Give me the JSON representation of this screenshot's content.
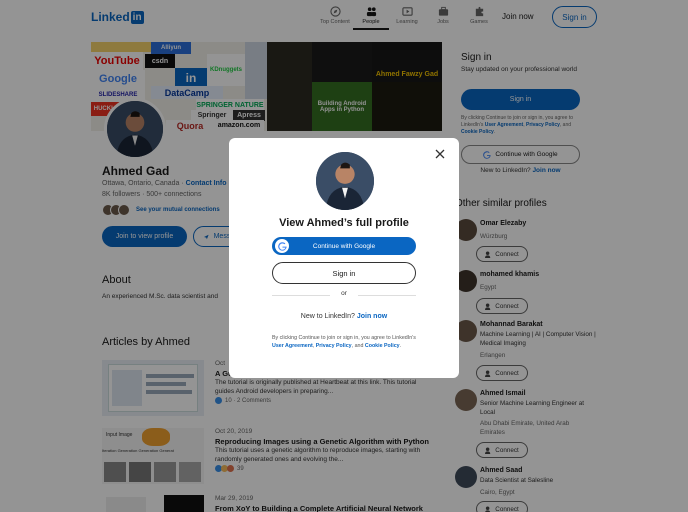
{
  "header": {
    "logo_text": "Linked",
    "logo_in": "in",
    "nav": [
      {
        "label": "Top Content",
        "icon": "compass-icon"
      },
      {
        "label": "People",
        "icon": "people-icon"
      },
      {
        "label": "Learning",
        "icon": "play-icon"
      },
      {
        "label": "Jobs",
        "icon": "briefcase-icon"
      },
      {
        "label": "Games",
        "icon": "puzzle-icon"
      }
    ],
    "join_now": "Join now",
    "sign_in": "Sign in"
  },
  "banner": {
    "tiles": [
      "YouTube",
      "Google",
      "csdn",
      "in",
      "DataCamp",
      "SPRINGER NATURE",
      "Springer",
      "Apress",
      "Quora",
      "amazon.com",
      "Alliyun",
      "KDnuggets",
      "Ahmed Fawzy Gad",
      "Building Android Apps in Python",
      "SLIDESHARE",
      "HUCKLY"
    ]
  },
  "profile": {
    "name": "Ahmed Gad",
    "location": "Ottawa, Ontario, Canada",
    "contact": "Contact Info",
    "followers": "8K followers",
    "connections": "500+ connections",
    "mutual": "See your mutual connections",
    "join_to_view": "Join to view profile",
    "message": "Message"
  },
  "about": {
    "heading": "About",
    "text": "An experienced M.Sc. data scientist and"
  },
  "articles": {
    "heading": "Articles by Ahmed",
    "items": [
      {
        "date": "Oct",
        "title": "A Gu",
        "desc": "The tutorial is originally published at Heartbeat at this link. This tutorial guides Android developers in preparing...",
        "reactions": "10 · 2 Comments"
      },
      {
        "date": "Oct 20, 2019",
        "title": "Reproducing Images using a Genetic Algorithm with Python",
        "desc": "This tutorial uses a genetic algorithm to reproduce images, starting with randomly generated ones and evolving the...",
        "reactions": "39"
      },
      {
        "date": "Mar 29, 2019",
        "title": "From XoY to Building a Complete Artificial Neural Network",
        "desc": "",
        "reactions": ""
      }
    ]
  },
  "sidebar": {
    "heading": "Sign in",
    "subtitle": "Stay updated on your professional world",
    "signin_button": "Sign in",
    "legal_pre": "By clicking Continue to join or sign in, you agree to LinkedIn's ",
    "legal_ua": "User Agreement",
    "legal_mid": ", ",
    "legal_pp": "Privacy Policy",
    "legal_and": ", and ",
    "legal_cp": "Cookie Policy",
    "legal_end": ".",
    "google_button": "Continue with Google",
    "new_to": "New to LinkedIn? ",
    "join": "Join now"
  },
  "similar": {
    "heading": "Other similar profiles",
    "connect_label": "Connect",
    "people": [
      {
        "name": "Omar Elezaby",
        "headline": "",
        "location": "Würzburg"
      },
      {
        "name": "mohamed khamis",
        "headline": "",
        "location": "Egypt"
      },
      {
        "name": "Mohannad Barakat",
        "headline": "Machine Learning | AI | Computer Vision | Medical Imaging",
        "location": "Erlangen"
      },
      {
        "name": "Ahmed Ismail",
        "headline": "Senior Machine Learning Engineer at Local",
        "location": "Abu Dhabi Emirate, United Arab Emirates"
      },
      {
        "name": "Ahmed Saad",
        "headline": "Data Scientist at Salesline",
        "location": "Cairo, Egypt"
      }
    ]
  },
  "modal": {
    "title": "View Ahmed’s full profile",
    "google": "Continue with Google",
    "signin": "Sign in",
    "or": "or",
    "new_to": "New to LinkedIn? ",
    "join": "Join now",
    "legal_pre": "By clicking Continue to join or sign in, you agree to LinkedIn’s ",
    "legal_ua": "User Agreement",
    "legal_mid": ", ",
    "legal_pp": "Privacy Policy",
    "legal_and": ", and ",
    "legal_cp": "Cookie Policy",
    "legal_end": "."
  },
  "colors": {
    "brand": "#0a66c2",
    "overlay": "rgba(0,0,0,0.42)"
  }
}
